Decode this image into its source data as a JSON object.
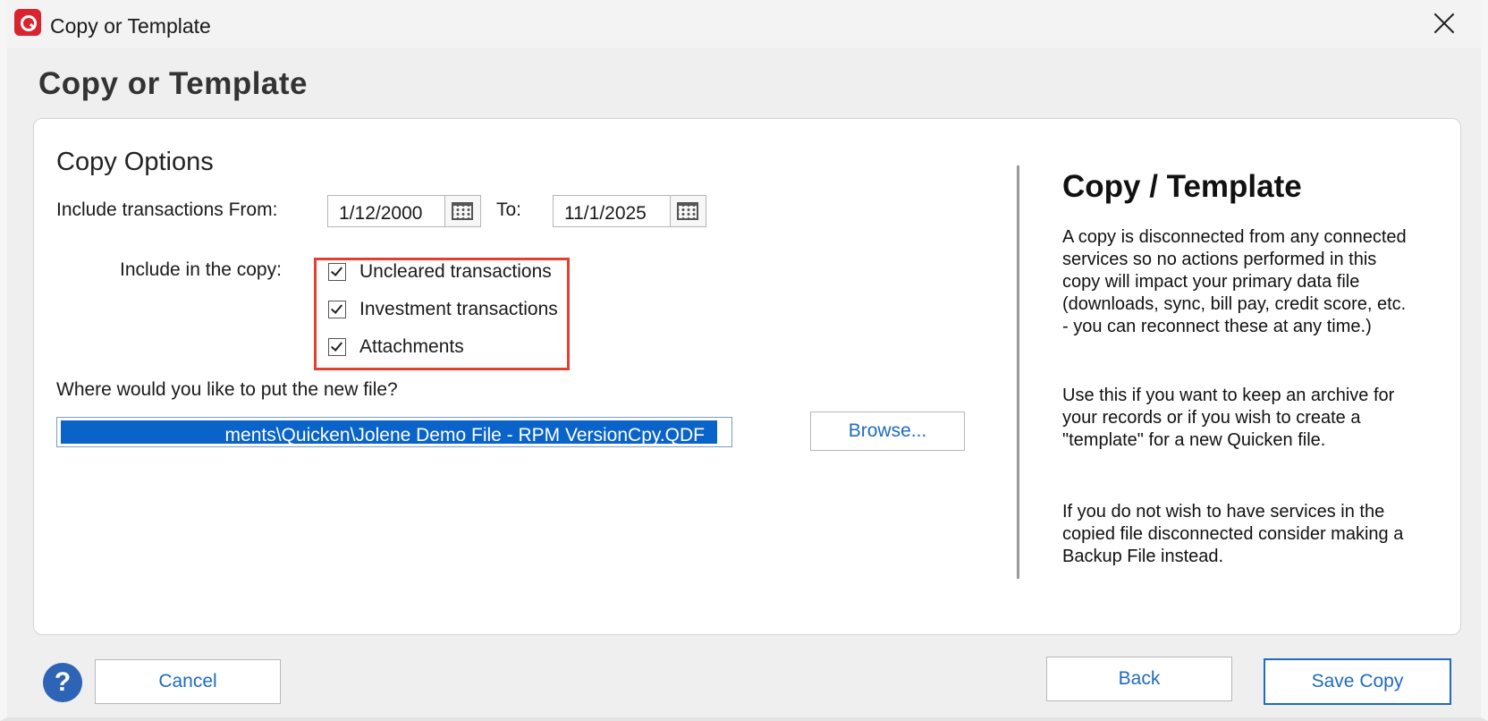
{
  "window": {
    "title": "Copy or Template",
    "close_icon": "close-icon",
    "app_icon": "quicken-logo-icon"
  },
  "page_title": "Copy or Template",
  "copy_options": {
    "section_title": "Copy Options",
    "from_label": "Include transactions From:",
    "from_date": "1/12/2000",
    "to_label": "To:",
    "to_date": "11/1/2025",
    "include_label": "Include in the copy:",
    "checkboxes": [
      {
        "label": "Uncleared transactions",
        "checked": true
      },
      {
        "label": "Investment transactions",
        "checked": true
      },
      {
        "label": "Attachments",
        "checked": true
      }
    ],
    "location_label": "Where would you like to put the new file?",
    "file_path": "ments\\Quicken\\Jolene Demo File - RPM VersionCpy.QDF",
    "browse_label": "Browse..."
  },
  "sidebar": {
    "title": "Copy / Template",
    "paragraphs": [
      "A copy is disconnected from any connected services so no actions performed in this copy will impact your primary data file (downloads, sync, bill pay, credit score, etc. - you can reconnect these at any time.)",
      "Use this if you want to keep an archive for your records or if you wish to create a \"template\" for a new Quicken file.",
      "If you do not wish to have services in the copied file disconnected consider making a Backup File instead."
    ]
  },
  "footer": {
    "help_label": "?",
    "cancel_label": "Cancel",
    "back_label": "Back",
    "save_label": "Save Copy"
  },
  "colors": {
    "highlight_border": "#e4402f",
    "accent_blue": "#1f6bbf",
    "selection_blue": "#0a63c9",
    "app_red": "#d9232e"
  }
}
